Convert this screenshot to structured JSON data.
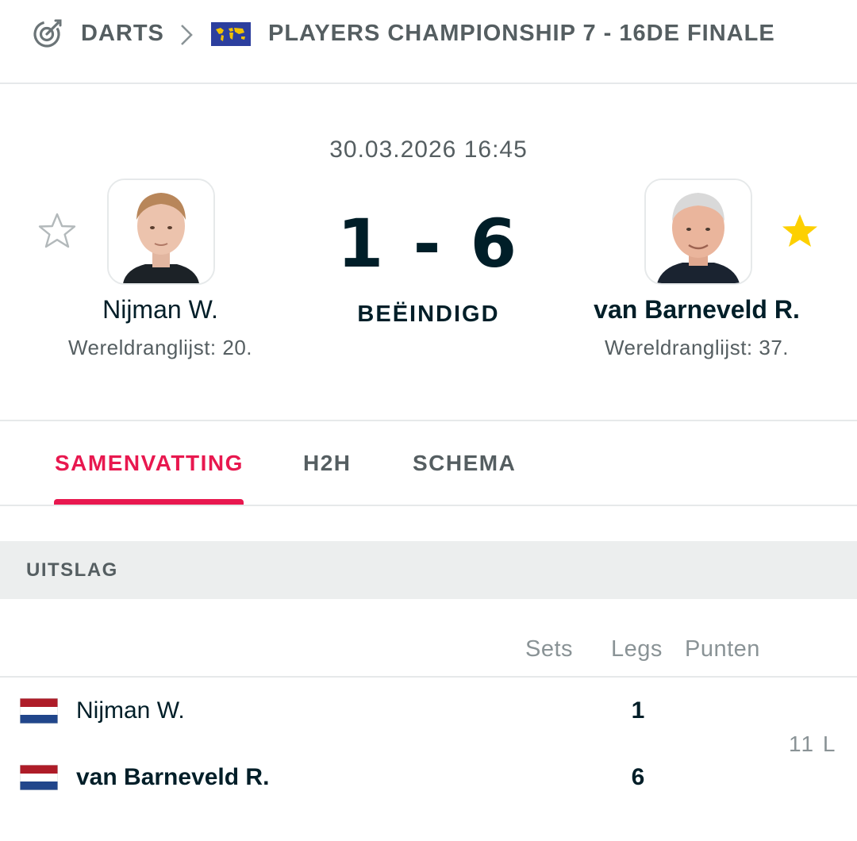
{
  "breadcrumb": {
    "sport": "DARTS",
    "tournament": "PLAYERS CHAMPIONSHIP 7 - 16DE FINALE"
  },
  "match": {
    "datetime": "30.03.2026 16:45",
    "score": "1 - 6",
    "status": "BEËINDIGD",
    "home": {
      "name": "Nijman W.",
      "rank": "Wereldranglijst: 20.",
      "favorite": false
    },
    "away": {
      "name": "van Barneveld R.",
      "rank": "Wereldranglijst: 37.",
      "favorite": true
    }
  },
  "tabs": [
    {
      "label": "SAMENVATTING",
      "active": true
    },
    {
      "label": "H2H",
      "active": false
    },
    {
      "label": "SCHEMA",
      "active": false
    }
  ],
  "result": {
    "section_title": "UITSLAG",
    "columns": [
      "Sets",
      "Legs",
      "Punten"
    ],
    "rows": [
      {
        "name": "Nijman W.",
        "legs": "1",
        "country": "Netherlands"
      },
      {
        "name": "van Barneveld R.",
        "legs": "6",
        "country": "Netherlands"
      }
    ],
    "points_note": "11 L"
  },
  "colors": {
    "accent": "#e8184f",
    "text": "#001e28",
    "muted": "#555e61",
    "star": "#fdd000"
  }
}
